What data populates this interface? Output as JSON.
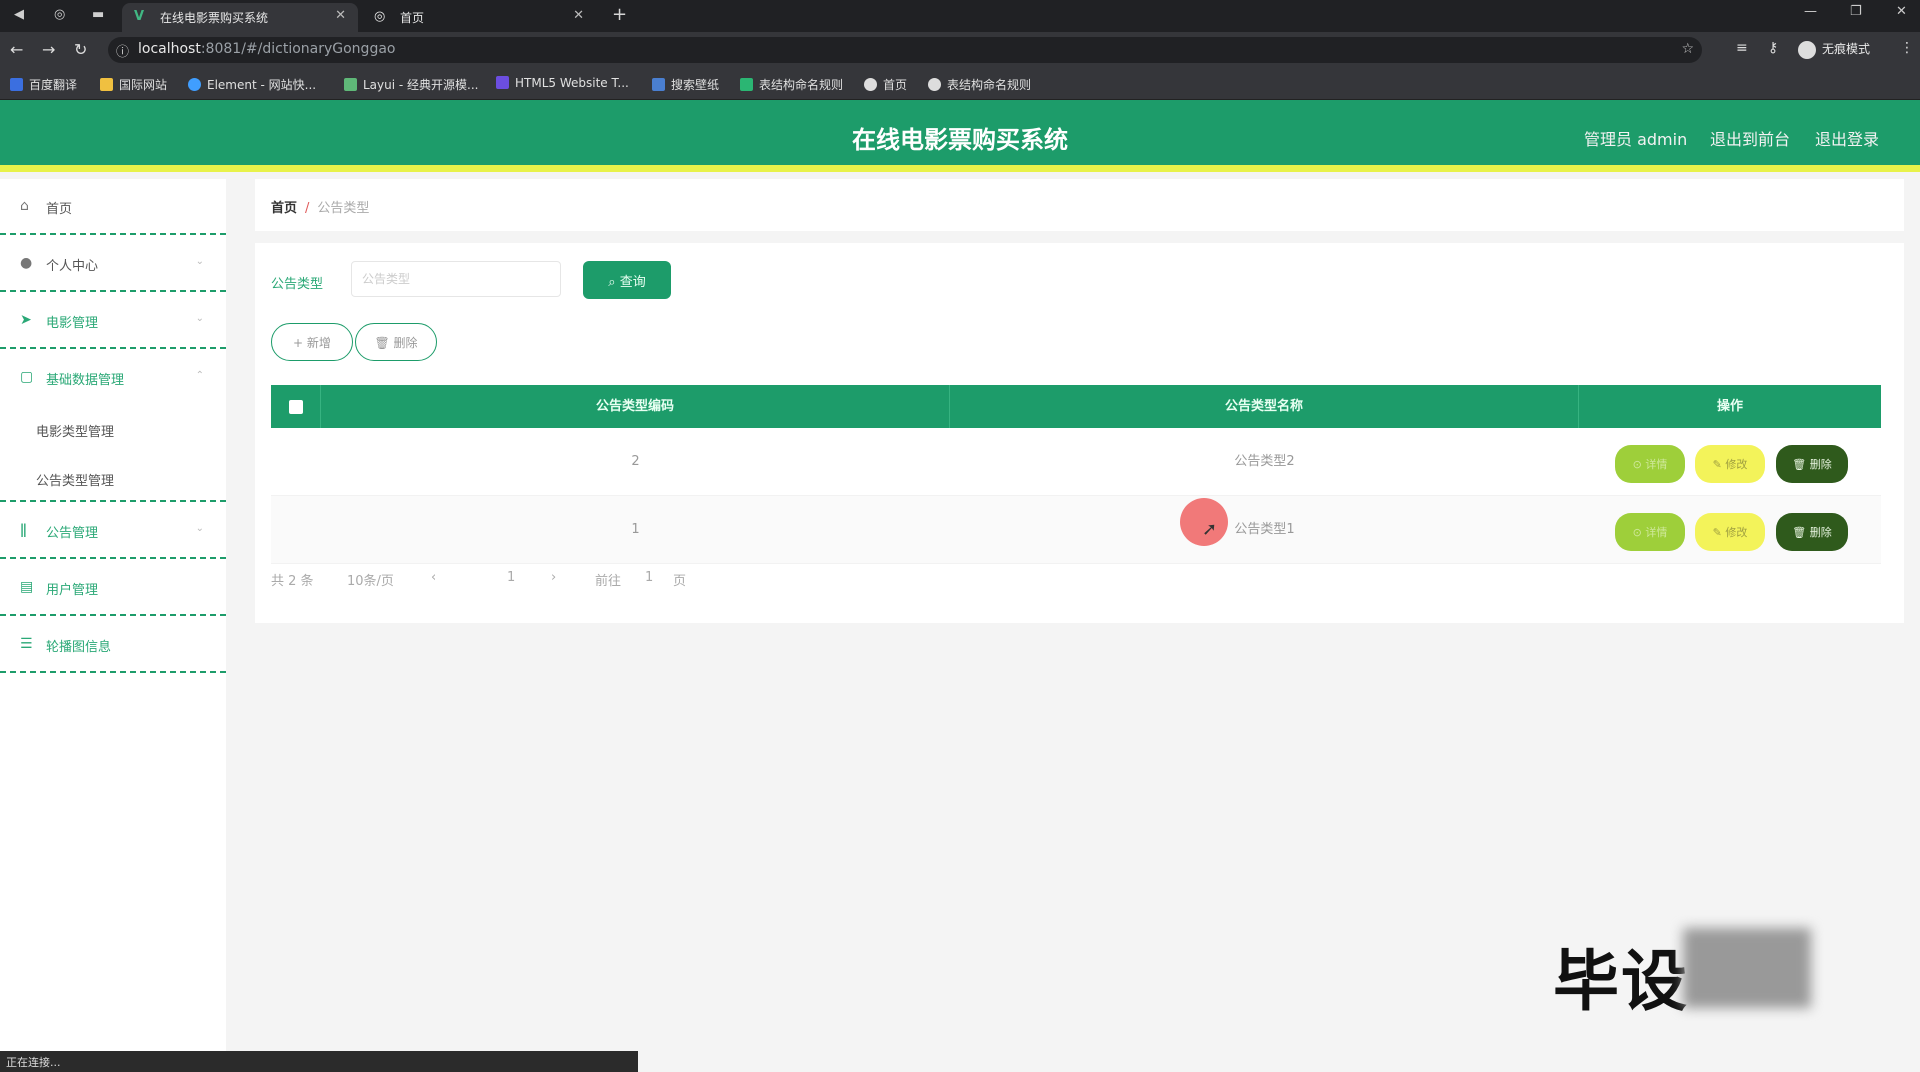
{
  "browser": {
    "tabs": [
      {
        "title": "在线电影票购买系统",
        "active": true
      },
      {
        "title": "首页",
        "active": false
      }
    ],
    "url_host": "localhost",
    "url_rest": ":8081/#/dictionaryGonggao",
    "profile_label": "无痕模式",
    "bookmarks": [
      "百度翻译",
      "国际网站",
      "Element - 网站快...",
      "Layui - 经典开源模...",
      "HTML5 Website T...",
      "搜索壁纸",
      "表结构命名规则",
      "首页",
      "表结构命名规则"
    ],
    "status": "正在连接..."
  },
  "header": {
    "title": "在线电影票购买系统",
    "admin_label": "管理员 admin",
    "front_label": "退出到前台",
    "logout_label": "退出登录"
  },
  "sidebar": {
    "items": [
      {
        "label": "首页",
        "icon": "home-icon"
      },
      {
        "label": "个人中心",
        "icon": "user-icon"
      },
      {
        "label": "电影管理",
        "icon": "send-icon"
      },
      {
        "label": "基础数据管理",
        "icon": "folder-icon"
      },
      {
        "label": "公告管理",
        "icon": "bulb-icon"
      },
      {
        "label": "用户管理",
        "icon": "list-icon"
      },
      {
        "label": "轮播图信息",
        "icon": "stack-icon"
      }
    ],
    "sub_items": [
      "电影类型管理",
      "公告类型管理"
    ]
  },
  "breadcrumb": {
    "home": "首页",
    "separator": "/",
    "current": "公告类型"
  },
  "search": {
    "label": "公告类型",
    "placeholder": "公告类型",
    "query_label": "查询"
  },
  "toolbar": {
    "add_label": "新增",
    "delete_label": "删除"
  },
  "table": {
    "headers": [
      "公告类型编码",
      "公告类型名称",
      "操作"
    ],
    "rows": [
      {
        "code": "2",
        "name": "公告类型2"
      },
      {
        "code": "1",
        "name": "公告类型1"
      }
    ],
    "actions": {
      "detail": "详情",
      "edit": "修改",
      "delete": "删除"
    }
  },
  "pagination": {
    "total": "共 2 条",
    "page_size": "10条/页",
    "current_page": "1",
    "goto_label": "前往",
    "goto_value": "1",
    "page_unit": "页"
  },
  "watermark": "毕设"
}
